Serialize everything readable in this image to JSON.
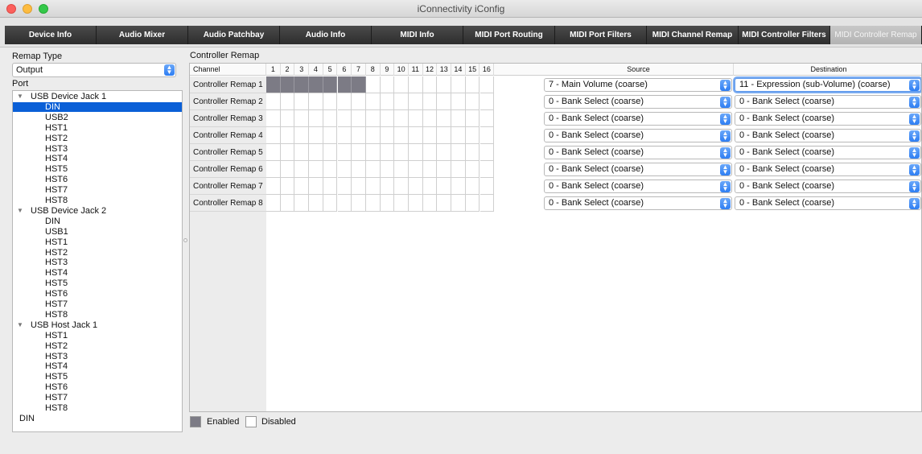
{
  "window": {
    "title": "iConnectivity iConfig"
  },
  "tabs": [
    "Device Info",
    "Audio Mixer",
    "Audio Patchbay",
    "Audio Info",
    "MIDI Info",
    "MIDI Port Routing",
    "MIDI Port Filters",
    "MIDI Channel Remap",
    "MIDI Controller Filters",
    "MIDI Controller Remap"
  ],
  "active_tab": "MIDI Controller Remap",
  "left": {
    "remap_type_label": "Remap Type",
    "remap_type_value": "Output",
    "port_label": "Port",
    "tree": [
      {
        "type": "group",
        "label": "USB Device Jack 1"
      },
      {
        "type": "leaf",
        "label": "DIN",
        "selected": true
      },
      {
        "type": "leaf",
        "label": "USB2"
      },
      {
        "type": "leaf",
        "label": "HST1"
      },
      {
        "type": "leaf",
        "label": "HST2"
      },
      {
        "type": "leaf",
        "label": "HST3"
      },
      {
        "type": "leaf",
        "label": "HST4"
      },
      {
        "type": "leaf",
        "label": "HST5"
      },
      {
        "type": "leaf",
        "label": "HST6"
      },
      {
        "type": "leaf",
        "label": "HST7"
      },
      {
        "type": "leaf",
        "label": "HST8"
      },
      {
        "type": "group",
        "label": "USB Device Jack 2"
      },
      {
        "type": "leaf",
        "label": "DIN"
      },
      {
        "type": "leaf",
        "label": "USB1"
      },
      {
        "type": "leaf",
        "label": "HST1"
      },
      {
        "type": "leaf",
        "label": "HST2"
      },
      {
        "type": "leaf",
        "label": "HST3"
      },
      {
        "type": "leaf",
        "label": "HST4"
      },
      {
        "type": "leaf",
        "label": "HST5"
      },
      {
        "type": "leaf",
        "label": "HST6"
      },
      {
        "type": "leaf",
        "label": "HST7"
      },
      {
        "type": "leaf",
        "label": "HST8"
      },
      {
        "type": "group",
        "label": "USB Host Jack 1"
      },
      {
        "type": "leaf",
        "label": "HST1"
      },
      {
        "type": "leaf",
        "label": "HST2"
      },
      {
        "type": "leaf",
        "label": "HST3"
      },
      {
        "type": "leaf",
        "label": "HST4"
      },
      {
        "type": "leaf",
        "label": "HST5"
      },
      {
        "type": "leaf",
        "label": "HST6"
      },
      {
        "type": "leaf",
        "label": "HST7"
      },
      {
        "type": "leaf",
        "label": "HST8"
      },
      {
        "type": "plain",
        "label": "DIN"
      }
    ]
  },
  "remap": {
    "section_label": "Controller Remap",
    "channel_header": "Channel",
    "channels": [
      "1",
      "2",
      "3",
      "4",
      "5",
      "6",
      "7",
      "8",
      "9",
      "10",
      "11",
      "12",
      "13",
      "14",
      "15",
      "16"
    ],
    "source_header": "Source",
    "destination_header": "Destination",
    "rows": [
      {
        "name": "Controller Remap 1",
        "enabled_channels": [
          1,
          2,
          3,
          4,
          5,
          6,
          7
        ],
        "source": "7 - Main Volume (coarse)",
        "destination": "11 - Expression (sub-Volume) (coarse)"
      },
      {
        "name": "Controller Remap 2",
        "enabled_channels": [],
        "source": "0 - Bank Select (coarse)",
        "destination": "0 - Bank Select (coarse)"
      },
      {
        "name": "Controller Remap 3",
        "enabled_channels": [],
        "source": "0 - Bank Select (coarse)",
        "destination": "0 - Bank Select (coarse)"
      },
      {
        "name": "Controller Remap 4",
        "enabled_channels": [],
        "source": "0 - Bank Select (coarse)",
        "destination": "0 - Bank Select (coarse)"
      },
      {
        "name": "Controller Remap 5",
        "enabled_channels": [],
        "source": "0 - Bank Select (coarse)",
        "destination": "0 - Bank Select (coarse)"
      },
      {
        "name": "Controller Remap 6",
        "enabled_channels": [],
        "source": "0 - Bank Select (coarse)",
        "destination": "0 - Bank Select (coarse)"
      },
      {
        "name": "Controller Remap 7",
        "enabled_channels": [],
        "source": "0 - Bank Select (coarse)",
        "destination": "0 - Bank Select (coarse)"
      },
      {
        "name": "Controller Remap 8",
        "enabled_channels": [],
        "source": "0 - Bank Select (coarse)",
        "destination": "0 - Bank Select (coarse)"
      }
    ]
  },
  "legend": {
    "enabled": "Enabled",
    "disabled": "Disabled"
  },
  "colors": {
    "enabled": "#7c7b85",
    "selection": "#0a5fd7",
    "accent": "#2e7ef3"
  }
}
